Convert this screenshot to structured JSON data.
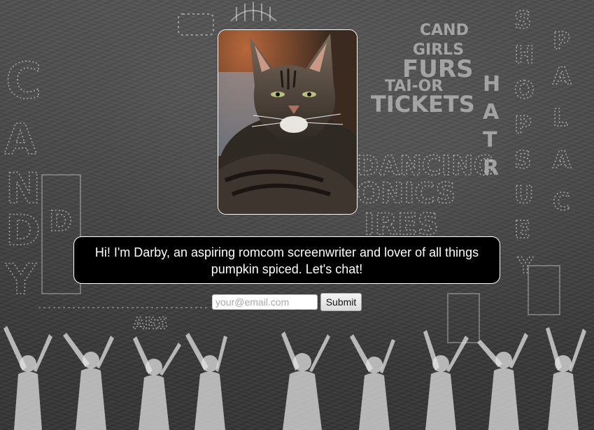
{
  "background": {
    "description_icon": "vintage-chorus-line-poster",
    "colors": {
      "base": "#3f3f3f",
      "chalk": "#e6e6e6"
    }
  },
  "profile": {
    "photo_icon": "tabby-cat-photo",
    "message": "Hi! I'm Darby, an aspiring romcom screenwriter and lover of all things pumpkin spiced. Let's chat!"
  },
  "form": {
    "email_placeholder": "your@email.com",
    "submit_label": "Submit"
  },
  "colors": {
    "bubble_bg": "#000000",
    "bubble_text": "#ffffff",
    "bubble_border": "#ffffff"
  }
}
